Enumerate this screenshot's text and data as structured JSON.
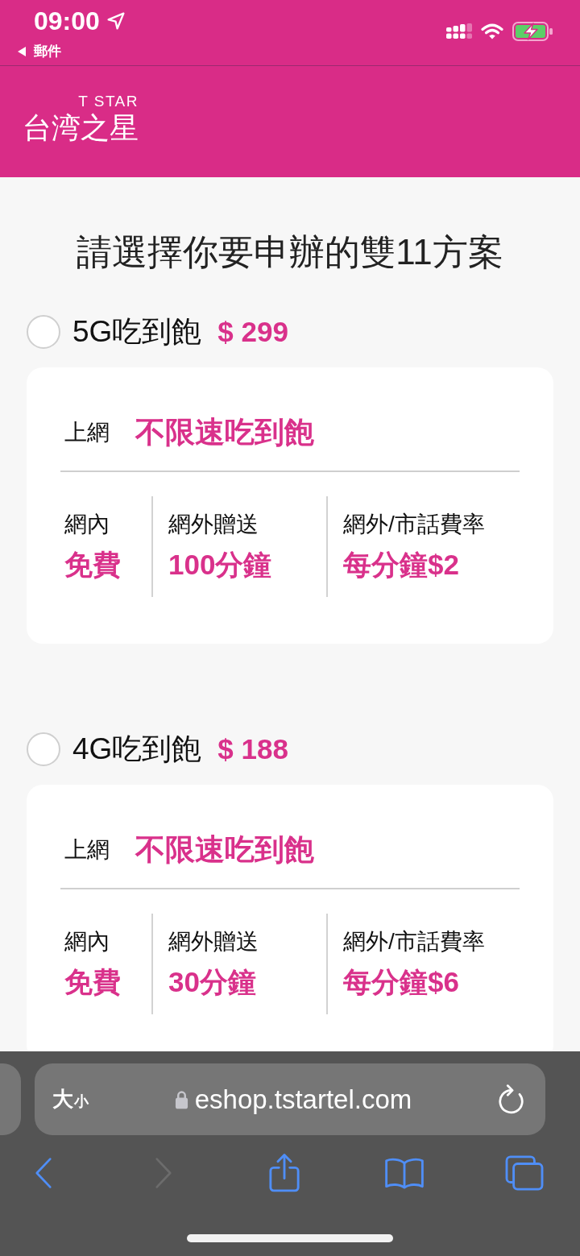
{
  "status_bar": {
    "time": "09:00",
    "back_link": "郵件"
  },
  "header": {
    "logo_subtitle": "T STAR",
    "logo_wordmark": "台湾之星"
  },
  "title": "請選擇你要申辦的雙11方案",
  "plans": [
    {
      "name": "5G吃到飽",
      "price": "$ 299",
      "selected": false,
      "data": {
        "label": "上網",
        "value": "不限速吃到飽"
      },
      "rates": [
        {
          "label": "網內",
          "value": "免費"
        },
        {
          "label": "網外贈送",
          "value": "100分鐘"
        },
        {
          "label": "網外/市話費率",
          "value": "每分鐘$2"
        }
      ]
    },
    {
      "name": "4G吃到飽",
      "price": "$ 188",
      "selected": false,
      "data": {
        "label": "上網",
        "value": "不限速吃到飽"
      },
      "rates": [
        {
          "label": "網內",
          "value": "免費"
        },
        {
          "label": "網外贈送",
          "value": "30分鐘"
        },
        {
          "label": "網外/市話費率",
          "value": "每分鐘$6"
        }
      ]
    }
  ],
  "browser": {
    "text_size": {
      "large": "大",
      "small": "小"
    },
    "url": "eshop.tstartel.com",
    "toolbar": [
      {
        "kind": "back",
        "disabled": false
      },
      {
        "kind": "forward",
        "disabled": true
      },
      {
        "kind": "share",
        "disabled": false
      },
      {
        "kind": "bookmarks",
        "disabled": false
      },
      {
        "kind": "tabs",
        "disabled": false
      }
    ]
  }
}
